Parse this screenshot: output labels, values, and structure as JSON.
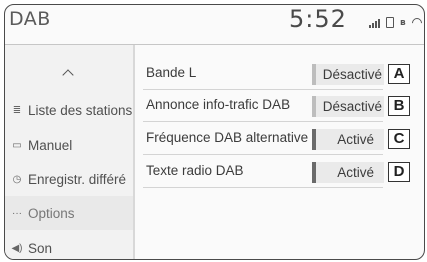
{
  "header": {
    "title": "DAB",
    "clock": "5:52"
  },
  "sidebar": {
    "items": [
      {
        "label": "Liste des stations",
        "icon": "station-list-icon"
      },
      {
        "label": "Manuel",
        "icon": "manual-tune-icon"
      },
      {
        "label": "Enregistr. différé",
        "icon": "time-shift-icon"
      },
      {
        "label": "Options",
        "icon": "more-dots-icon",
        "selected": true
      },
      {
        "label": "Son",
        "icon": "speaker-icon"
      }
    ]
  },
  "settings": [
    {
      "label": "Bande L",
      "state": "Désactivé",
      "on": false,
      "callout": "A"
    },
    {
      "label": "Annonce info-trafic DAB",
      "state": "Désactivé",
      "on": false,
      "callout": "B"
    },
    {
      "label": "Fréquence DAB alternative",
      "state": "Activé",
      "on": true,
      "callout": "C"
    },
    {
      "label": "Texte radio DAB",
      "state": "Activé",
      "on": true,
      "callout": "D"
    }
  ],
  "colors": {
    "active_indicator": "#6a6a6a",
    "inactive_indicator": "#bdbdbd"
  }
}
